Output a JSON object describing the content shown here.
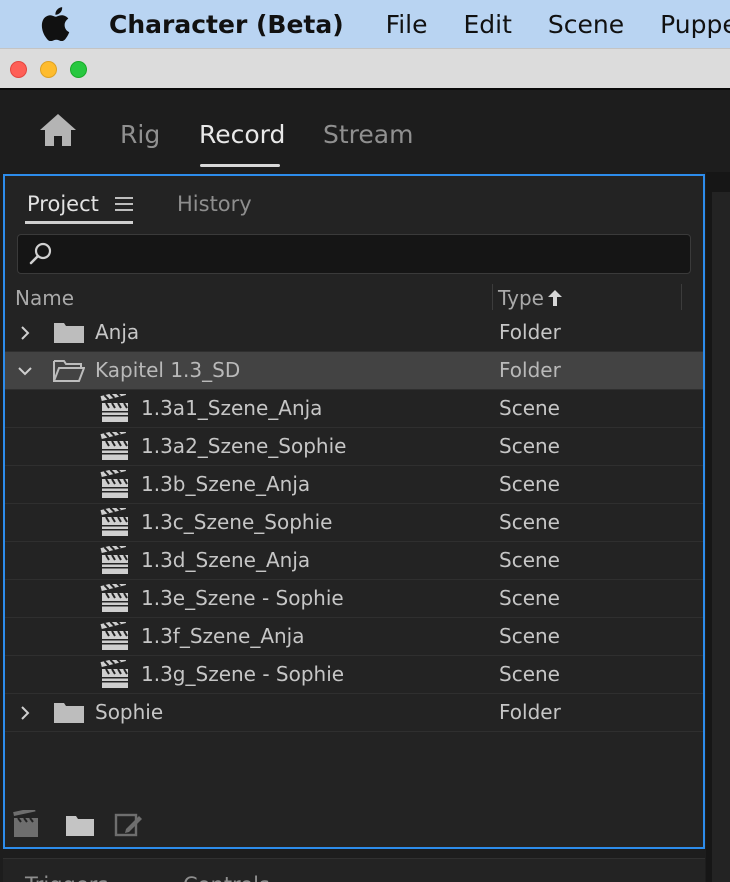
{
  "menubar": {
    "app_name": "Character (Beta)",
    "items": [
      "File",
      "Edit",
      "Scene",
      "Puppet"
    ]
  },
  "workspace_tabs": {
    "items": [
      "Rig",
      "Record",
      "Stream"
    ],
    "active": "Record"
  },
  "project_panel": {
    "tabs": [
      "Project",
      "History"
    ],
    "active_tab": "Project",
    "search": {
      "value": "",
      "placeholder": ""
    },
    "columns": {
      "name": "Name",
      "type": "Type",
      "sort": "ascending"
    },
    "rows": [
      {
        "name": "Anja",
        "type": "Folder",
        "kind": "folder",
        "expanded": false,
        "level": 0
      },
      {
        "name": "Kapitel 1.3_SD",
        "type": "Folder",
        "kind": "folder",
        "expanded": true,
        "level": 0,
        "selected": true
      },
      {
        "name": "1.3a1_Szene_Anja",
        "type": "Scene",
        "kind": "scene",
        "level": 1
      },
      {
        "name": "1.3a2_Szene_Sophie",
        "type": "Scene",
        "kind": "scene",
        "level": 1
      },
      {
        "name": "1.3b_Szene_Anja",
        "type": "Scene",
        "kind": "scene",
        "level": 1
      },
      {
        "name": "1.3c_Szene_Sophie",
        "type": "Scene",
        "kind": "scene",
        "level": 1
      },
      {
        "name": "1.3d_Szene_Anja",
        "type": "Scene",
        "kind": "scene",
        "level": 1
      },
      {
        "name": "1.3e_Szene - Sophie",
        "type": "Scene",
        "kind": "scene",
        "level": 1
      },
      {
        "name": "1.3f_Szene_Anja",
        "type": "Scene",
        "kind": "scene",
        "level": 1
      },
      {
        "name": "1.3g_Szene - Sophie",
        "type": "Scene",
        "kind": "scene",
        "level": 1
      },
      {
        "name": "Sophie",
        "type": "Folder",
        "kind": "folder",
        "expanded": false,
        "level": 0
      }
    ],
    "footer_icons": [
      "new-scene-icon",
      "new-folder-icon",
      "edit-icon"
    ]
  },
  "lower_panel": {
    "tabs": [
      "Triggers",
      "Controls"
    ]
  },
  "colors": {
    "menubar_bg": "#b9d4f2",
    "panel_focus_border": "#2d8ceb",
    "selected_row": "#434343"
  }
}
